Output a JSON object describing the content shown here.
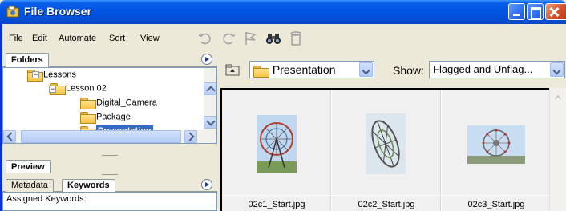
{
  "window": {
    "title": "File Browser",
    "icons": [
      "file-browser-app-icon",
      "minimize-icon",
      "maximize-icon",
      "close-icon"
    ],
    "accent": "#0055E5"
  },
  "menu": {
    "items": [
      "File",
      "Edit",
      "Automate",
      "Sort",
      "View"
    ]
  },
  "toolbar": {
    "icons": [
      "rotate-ccw-icon",
      "rotate-cw-icon",
      "flag-icon",
      "binoculars-icon",
      "trash-icon"
    ]
  },
  "folders_panel": {
    "tab_label": "Folders",
    "tree": [
      {
        "label": "Lessons"
      },
      {
        "label": "Lesson 02"
      },
      {
        "label": "Digital_Camera"
      },
      {
        "label": "Package"
      },
      {
        "label": "Presentation",
        "selected": true
      }
    ]
  },
  "preview_panel": {
    "tab_label": "Preview"
  },
  "info_panel": {
    "tabs": [
      "Metadata",
      "Keywords"
    ],
    "active_tab": "Keywords",
    "assigned_label": "Assigned Keywords:"
  },
  "location": {
    "folder": "Presentation",
    "show_label": "Show:",
    "show_value": "Flagged and Unflag..."
  },
  "thumbnails": [
    {
      "caption": "02c1_Start.jpg",
      "icon": "ferris-wheel-vertical-photo"
    },
    {
      "caption": "02c2_Start.jpg",
      "icon": "ferris-wheel-angled-photo"
    },
    {
      "caption": "02c3_Start.jpg",
      "icon": "ferris-wheel-landscape-photo"
    }
  ]
}
